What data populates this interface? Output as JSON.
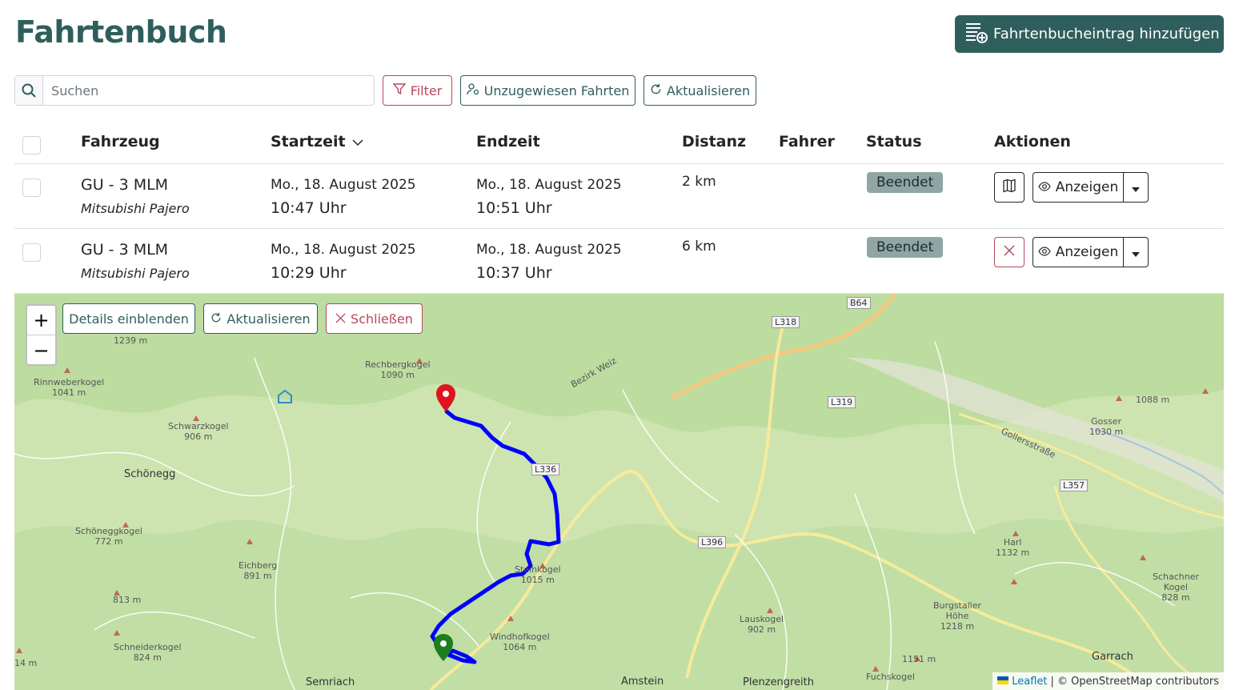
{
  "page": {
    "title": "Fahrtenbuch"
  },
  "header": {
    "add_button_label": "Fahrtenbucheintrag hinzufügen",
    "add_icon": "list-plus-icon"
  },
  "toolbar": {
    "search_placeholder": "Suchen",
    "filter_label": "Filter",
    "unassigned_label": "Unzugewiesen Fahrten",
    "refresh_label": "Aktualisieren"
  },
  "table": {
    "columns": [
      "Fahrzeug",
      "Startzeit",
      "Endzeit",
      "Distanz",
      "Fahrer",
      "Status",
      "Aktionen"
    ],
    "sort_column": "Startzeit",
    "rows": [
      {
        "vehicle": "GU - 3 MLM",
        "model": "Mitsubishi Pajero",
        "start_date": "Mo., 18. August 2025",
        "start_time": "10:47 Uhr",
        "end_date": "Mo., 18. August 2025",
        "end_time": "10:51 Uhr",
        "distance": "2 km",
        "driver": "",
        "status": "Beendet",
        "action_icon": "map-icon",
        "view_label": "Anzeigen"
      },
      {
        "vehicle": "GU - 3 MLM",
        "model": "Mitsubishi Pajero",
        "start_date": "Mo., 18. August 2025",
        "start_time": "10:29 Uhr",
        "end_date": "Mo., 18. August 2025",
        "end_time": "10:37 Uhr",
        "distance": "6 km",
        "driver": "",
        "status": "Beendet",
        "action_icon": "close-icon",
        "view_label": "Anzeigen"
      }
    ]
  },
  "map": {
    "zoom_in": "+",
    "zoom_out": "−",
    "details_label": "Details einblenden",
    "refresh_label": "Aktualisieren",
    "close_label": "Schließen",
    "attribution_link": "Leaflet",
    "attribution_text": "| © OpenStreetMap contributors",
    "route_color": "#0000ff",
    "start_marker_color": "#1e7d1e",
    "end_marker_color": "#e0141e",
    "labels": {
      "l1239": "1239 m",
      "rechberg": "Rechbergkogel",
      "rechberg_h": "1090 m",
      "rinnweber": "Rinnweberkogel",
      "rinnweber_h": "1041 m",
      "schwarz": "Schwarzkogel",
      "schwarz_h": "906 m",
      "schoenegg": "Schönegg",
      "schoeneggkogel": "Schöneggkogel",
      "schoeneggkogel_h": "772 m",
      "eichberg": "Eichberg",
      "eichberg_h": "891 m",
      "m813": "813 m",
      "schneider": "Schneiderkogel",
      "schneider_h": "824 m",
      "m14": "14 m",
      "semriach": "Semriach",
      "steinkogel": "Steinkogel",
      "steinkogel_h": "1015 m",
      "windhof": "Windhofkogel",
      "windhof_h": "1064 m",
      "amstein": "Amstein",
      "plenzen": "Plenzengreith",
      "fuchs": "Fuchskogel",
      "laus": "Lauskogel",
      "laus_h": "902 m",
      "burgstaller": "Burgstaller",
      "burgstaller_h1": "Höhe",
      "burgstaller_h2": "1218 m",
      "m1151": "1151 m",
      "harl": "Harl",
      "harl_h": "1132 m",
      "schachner": "Schachner",
      "schachner_h1": "Kogel",
      "schachner_h2": "828 m",
      "garrach": "Garrach",
      "gosser": "Gosser",
      "gosser_h": "1030 m",
      "m1088": "1088 m",
      "bezirk": "Bezirk Weiz",
      "gollersstr": "Gollersstraße",
      "b64": "B64",
      "l318": "L318",
      "l319": "L319",
      "l336": "L336",
      "l396": "L396",
      "l357": "L357"
    }
  }
}
